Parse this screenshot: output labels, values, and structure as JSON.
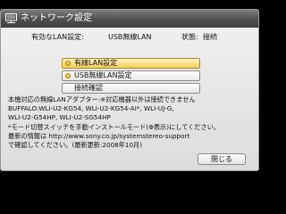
{
  "window": {
    "title": "ネットワーク設定",
    "icon": "network-icon"
  },
  "status": {
    "current_label": "有効なLAN設定:",
    "current_value": "USB無線LAN",
    "state_label": "状態:",
    "state_value": "接続"
  },
  "options": [
    {
      "label": "有線LAN設定",
      "icon": "dot-icon",
      "selected": true
    },
    {
      "label": "USB無線LAN設定",
      "icon": "dot-icon",
      "selected": false
    },
    {
      "label": "接続確認",
      "selected": false
    }
  ],
  "notes": {
    "lines": [
      "本機対応の無線LANアダプター:※対応機器以外は接続できません",
      "BUFFALO:WLI-U2-KG54, WLI-U2-KG54-AI*, WLI-UJ-G,",
      "WLI-U2-G54HP, WLI-U2-SG54HP",
      "*モード切替スイッチを手動インストールモード(Φ表示)にしてください。",
      "最新の情報は http://www.sony.co.jp/systemstereo-support",
      "で確認してください。(最新更新:2008年10月)"
    ]
  },
  "close_label": "閉じる",
  "colors": {
    "titlebar": "#4f4f4f",
    "selected": "#f3cf58",
    "panel": "#e8e8e8"
  }
}
